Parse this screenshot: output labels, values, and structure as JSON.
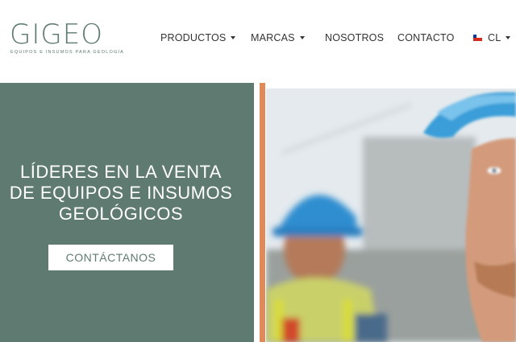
{
  "logo": {
    "wordmark": "GIGEO",
    "tagline": "EQUIPOS E INSUMOS PARA GEOLOGÍA"
  },
  "nav": {
    "items": [
      {
        "label": "PRODUCTOS",
        "has_dropdown": true
      },
      {
        "label": "MARCAS",
        "has_dropdown": true
      },
      {
        "label": "NOSOTROS",
        "has_dropdown": false
      },
      {
        "label": "CONTACTO",
        "has_dropdown": false
      }
    ],
    "language": {
      "label": "CL",
      "flag": "chile-flag-icon",
      "has_dropdown": true
    }
  },
  "hero": {
    "title_lines": [
      "LÍDERES EN LA VENTA",
      "DE EQUIPOS E INSUMOS",
      "GEOLÓGICOS"
    ],
    "cta_label": "CONTÁCTANOS",
    "photo": "geologists-hard-hats-photo"
  },
  "colors": {
    "brand": "#5f7a70",
    "accent": "#e08a5a",
    "text": "#333333",
    "white": "#ffffff"
  }
}
